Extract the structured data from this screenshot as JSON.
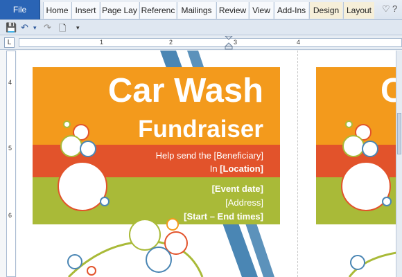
{
  "ribbon": {
    "file_label": "File",
    "tabs": [
      "Home",
      "Insert",
      "Page Lay",
      "Referenc",
      "Mailings",
      "Review",
      "View",
      "Add-Ins",
      "Design",
      "Layout"
    ]
  },
  "qat": {
    "save": "💾",
    "undo": "↶",
    "undo_arrow": "▾",
    "redo": "↷",
    "new": "🗋",
    "more": "▾"
  },
  "ruler": {
    "corner": "L",
    "marks": [
      "1",
      "2",
      "3",
      "4"
    ]
  },
  "vruler": {
    "marks": [
      "4",
      "5",
      "6"
    ]
  },
  "flyer": {
    "title_line1": "Car Wash",
    "title_line2": "Fundraiser",
    "help_text": "Help send the [Beneficiary]",
    "location_prefix": "In ",
    "location": "[Location]",
    "event_date": "[Event date]",
    "address": "[Address]",
    "times": "[Start – End times]"
  },
  "flyer_preview": {
    "title_initial": "C"
  },
  "colors": {
    "orange": "#f39a1c",
    "red": "#e2532b",
    "green": "#a9ba38",
    "blue_stripe": "#4a86b4"
  }
}
